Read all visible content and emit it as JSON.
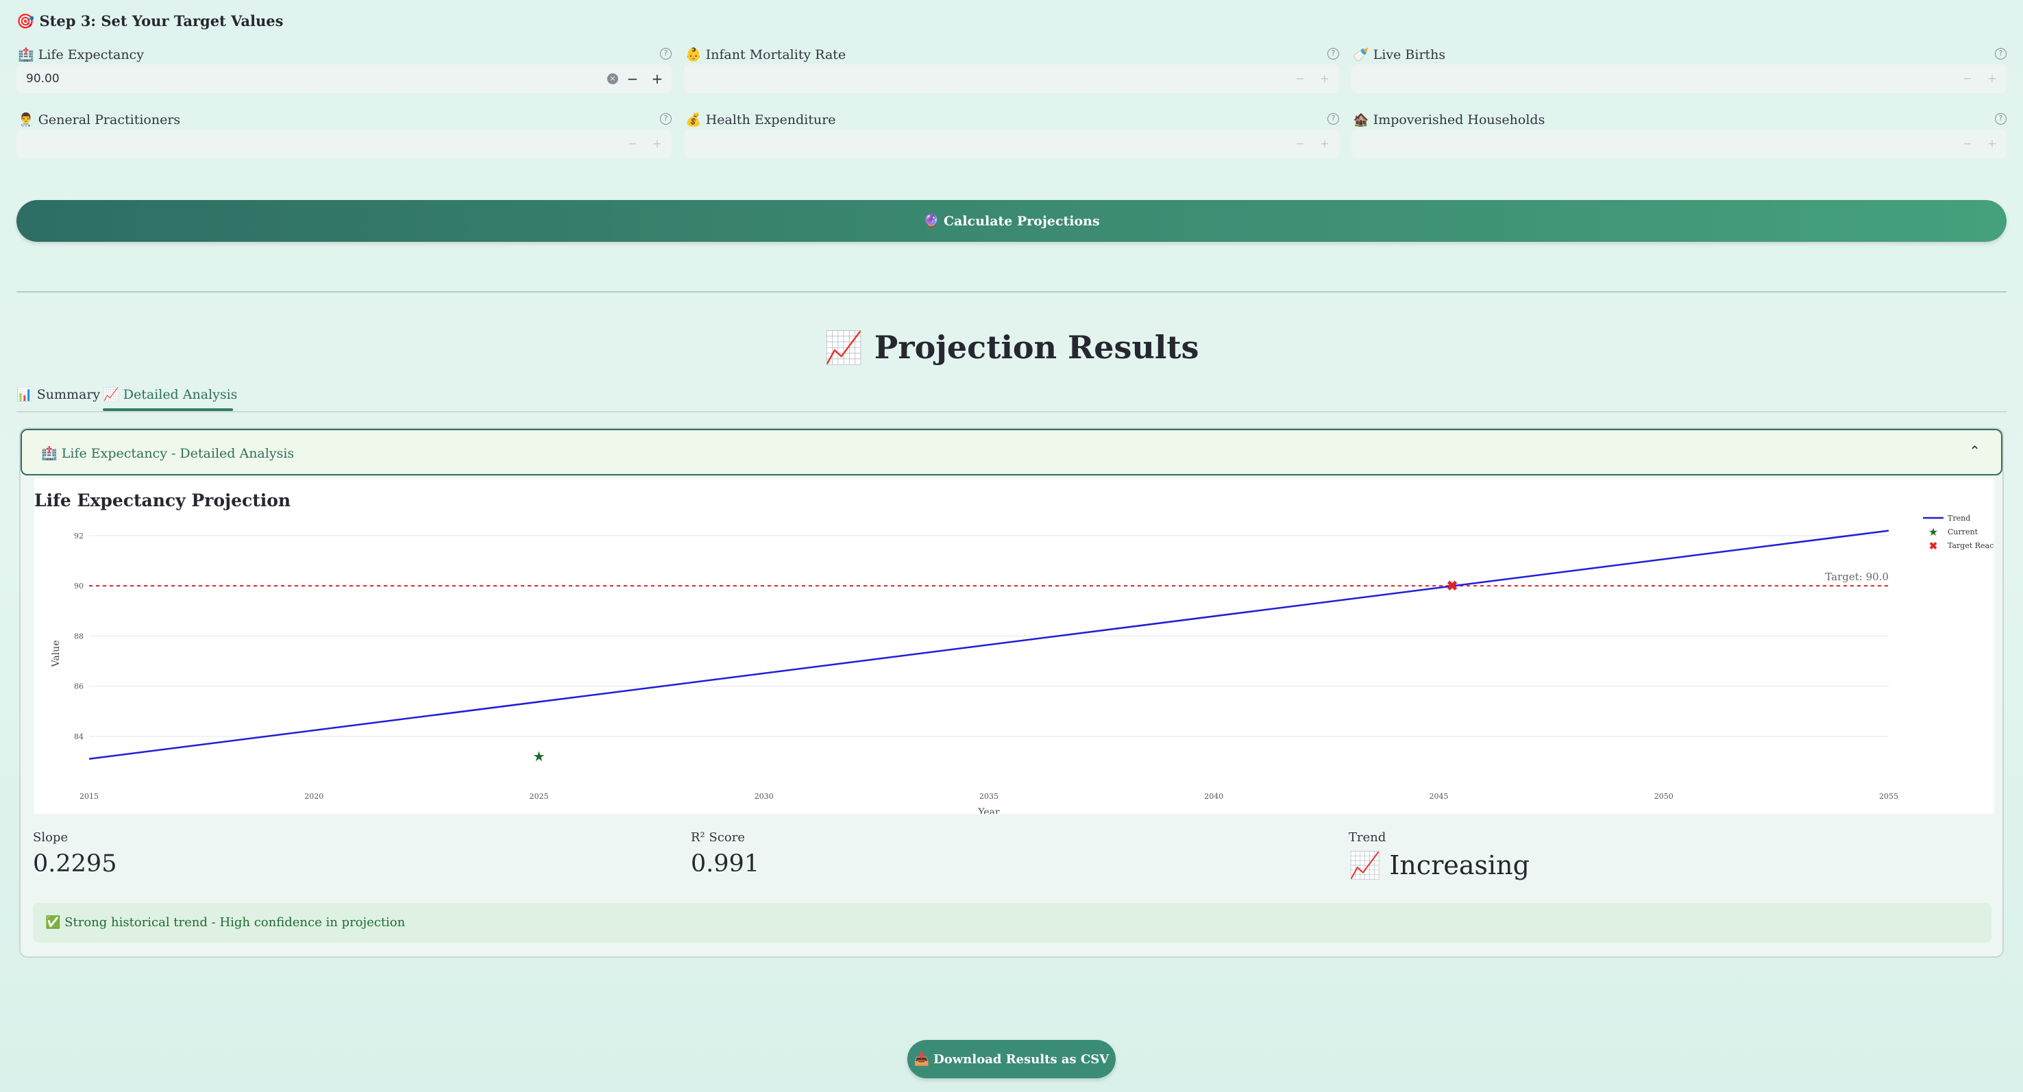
{
  "step": {
    "icon": "🎯",
    "title": "Step 3: Set Your Target Values"
  },
  "fields": [
    {
      "icon": "🏥",
      "label": "Life Expectancy",
      "value": "90.00",
      "help": "?"
    },
    {
      "icon": "👶",
      "label": "Infant Mortality Rate",
      "value": "",
      "help": "?"
    },
    {
      "icon": "🍼",
      "label": "Live Births",
      "value": "",
      "help": "?"
    },
    {
      "icon": "👨‍⚕️",
      "label": "General Practitioners",
      "value": "",
      "help": "?"
    },
    {
      "icon": "💰",
      "label": "Health Expenditure",
      "value": "",
      "help": "?"
    },
    {
      "icon": "🏚️",
      "label": "Impoverished Households",
      "value": "",
      "help": "?"
    }
  ],
  "calculate": {
    "icon": "🔮",
    "label": "Calculate Projections"
  },
  "results": {
    "icon": "📈",
    "title": "Projection Results"
  },
  "tabs": [
    {
      "icon": "📊",
      "label": "Summary"
    },
    {
      "icon": "📈",
      "label": "Detailed Analysis"
    }
  ],
  "expander": {
    "icon": "🏥",
    "title": "Life Expectancy - Detailed Analysis",
    "chevron": "⌃"
  },
  "chart_data": {
    "type": "line",
    "title": "Life Expectancy Projection",
    "xlabel": "Year",
    "ylabel": "Value",
    "xlim": [
      2015,
      2055
    ],
    "ylim": [
      82.0,
      92.6
    ],
    "x_ticks": [
      2015,
      2020,
      2025,
      2030,
      2035,
      2040,
      2045,
      2050,
      2055
    ],
    "y_ticks": [
      84,
      86,
      88,
      90,
      92
    ],
    "grid": true,
    "legend_position": "top-right",
    "series": [
      {
        "name": "Trend",
        "type": "line",
        "color": "#1f1fd6",
        "x": [
          2015,
          2055
        ],
        "y": [
          83.1,
          92.2
        ]
      },
      {
        "name": "Current",
        "type": "marker",
        "marker": "star",
        "color": "#1e6b26",
        "x": [
          2025
        ],
        "y": [
          83.2
        ]
      },
      {
        "name": "Target Reached",
        "type": "marker",
        "marker": "x",
        "color": "#e02424",
        "x": [
          2045.3
        ],
        "y": [
          90.0
        ]
      }
    ],
    "target": {
      "value": 90.0,
      "label": "Target: 90.0",
      "color": "#e02424"
    }
  },
  "metrics": {
    "slope": {
      "label": "Slope",
      "value": "0.2295"
    },
    "r2": {
      "label": "R² Score",
      "value": "0.991"
    },
    "trend": {
      "label": "Trend",
      "icon": "📈",
      "value": "Increasing"
    }
  },
  "success": {
    "icon": "✅",
    "text": "Strong historical trend - High confidence in projection"
  },
  "download": {
    "icon": "📥",
    "label": "Download Results as CSV"
  }
}
